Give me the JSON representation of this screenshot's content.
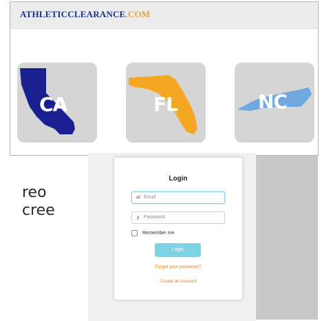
{
  "background": {
    "partial_text_lines": [
      "reo",
      "cree"
    ]
  },
  "site": {
    "logo": {
      "part1": "ATHLETIC",
      "part2": "CLEARANCE",
      "part3": ".COM"
    },
    "states": [
      {
        "label": "CA",
        "color": "#1a1f8f"
      },
      {
        "label": "FL",
        "color": "#f5a623"
      },
      {
        "label": "NC",
        "color": "#6ea8de"
      }
    ]
  },
  "login": {
    "title": "Login",
    "email_placeholder": "Email",
    "password_placeholder": "Password",
    "remember_label": "Remember me",
    "login_button": "Login",
    "forgot_link": "Forgot your password?",
    "create_link": "Create an Account"
  },
  "colors": {
    "accent": "#7fd2e4",
    "link": "#e07a16",
    "logo_blue": "#1d2f8c",
    "logo_gold": "#e2a33a"
  }
}
